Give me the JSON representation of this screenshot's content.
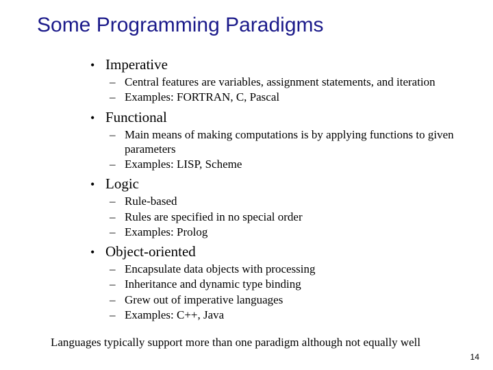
{
  "title": "Some Programming Paradigms",
  "sections": [
    {
      "heading": "Imperative",
      "subs": [
        "Central features are variables, assignment statements, and iteration",
        "Examples: FORTRAN, C, Pascal"
      ]
    },
    {
      "heading": "Functional",
      "subs": [
        "Main means of making computations is by applying functions to given parameters",
        "Examples: LISP, Scheme"
      ]
    },
    {
      "heading": "Logic",
      "subs": [
        "Rule-based",
        "Rules are specified in no special order",
        "Examples: Prolog"
      ]
    },
    {
      "heading": "Object-oriented",
      "subs": [
        "Encapsulate data objects with processing",
        "Inheritance and dynamic type binding",
        "Grew out of imperative languages",
        "Examples: C++, Java"
      ]
    }
  ],
  "footer": "Languages typically support more than one paradigm although not equally well",
  "page_number": "14",
  "bullet_glyph": "•",
  "dash_glyph": "–"
}
